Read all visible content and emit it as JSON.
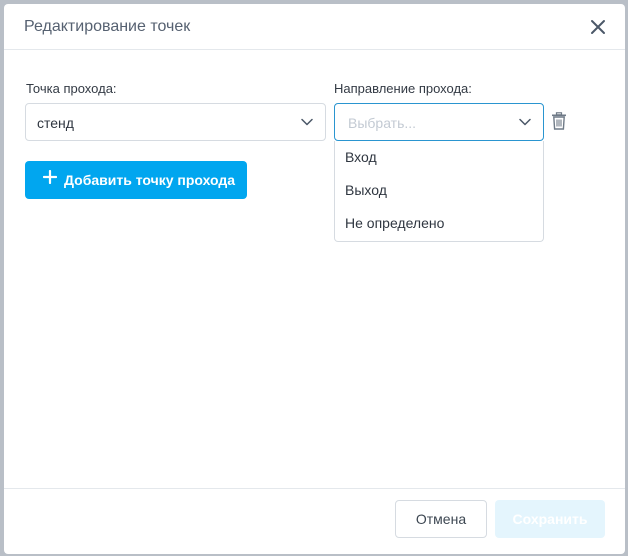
{
  "modal": {
    "title": "Редактирование точек"
  },
  "form": {
    "point_label": "Точка прохода:",
    "point_value": "стенд",
    "direction_label": "Направление прохода:",
    "direction_placeholder": "Выбрать...",
    "direction_options": [
      "Вход",
      "Выход",
      "Не определено"
    ],
    "add_button_label": "Добавить точку прохода"
  },
  "footer": {
    "cancel_label": "Отмена",
    "save_label": "Сохранить"
  },
  "icons": {
    "close": "close-icon",
    "chevron": "chevron-down-icon",
    "trash": "trash-icon",
    "plus": "plus-icon"
  },
  "colors": {
    "accent": "#01a6ef",
    "active_border": "#2a95d0",
    "save_disabled_bg": "#e4f5fd"
  }
}
